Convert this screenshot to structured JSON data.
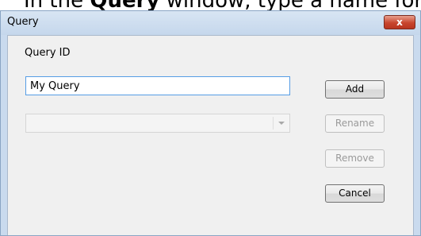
{
  "caption": {
    "prefix": "In the ",
    "strong": "Query",
    "suffix": " window, type a name for"
  },
  "window": {
    "title": "Query",
    "close_label": "x"
  },
  "form": {
    "query_id_label": "Query ID",
    "query_id_value": "My Query",
    "dropdown_value": ""
  },
  "buttons": {
    "add": "Add",
    "rename": "Rename",
    "remove": "Remove",
    "cancel": "Cancel"
  },
  "colors": {
    "title_bar": "#c9daee",
    "client_background": "#f0f0f0",
    "close_button": "#c8452d",
    "input_focus_border": "#569de5",
    "disabled_text": "#9a9a9a"
  },
  "icons": {
    "close": "close-icon",
    "dropdown": "chevron-down-icon"
  }
}
